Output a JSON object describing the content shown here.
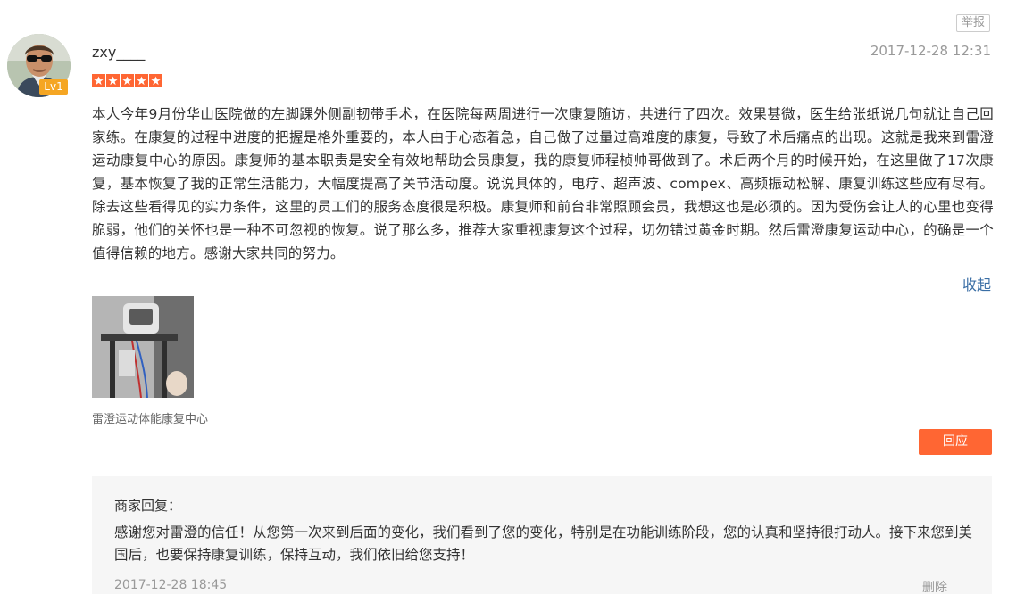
{
  "report_label": "举报",
  "user": {
    "name": "zxy____",
    "level": "Lv1",
    "rating": 5
  },
  "review": {
    "timestamp": "2017-12-28 12:31",
    "text": "本人今年9月份华山医院做的左脚踝外侧副韧带手术，在医院每两周进行一次康复随访，共进行了四次。效果甚微，医生给张纸说几句就让自己回家练。在康复的过程中进度的把握是格外重要的，本人由于心态着急，自己做了过量过高难度的康复，导致了术后痛点的出现。这就是我来到雷澄运动康复中心的原因。康复师的基本职责是安全有效地帮助会员康复，我的康复师程桢帅哥做到了。术后两个月的时候开始，在这里做了17次康复，基本恢复了我的正常生活能力，大幅度提高了关节活动度。说说具体的，电疗、超声波、compex、高频振动松解、康复训练这些应有尽有。除去这些看得见的实力条件，这里的员工们的服务态度很是积极。康复师和前台非常照顾会员，我想这也是必须的。因为受伤会让人的心里也变得脆弱，他们的关怀也是一种不可忽视的恢复。说了那么多，推荐大家重视康复这个过程，切勿错过黄金时期。然后雷澄康复运动中心，的确是一个值得信赖的地方。感谢大家共同的努力。",
    "collapse_label": "收起",
    "photo_caption": "雷澄运动体能康复中心",
    "reply_label": "回应"
  },
  "merchant_reply": {
    "title": "商家回复：",
    "text": "感谢您对雷澄的信任！从您第一次来到后面的变化，我们看到了您的变化，特别是在功能训练阶段，您的认真和坚持很打动人。接下来您到美国后，也要保持康复训练，保持互动，我们依旧给您支持！",
    "timestamp": "2017-12-28 18:45",
    "delete_label": "删除"
  },
  "colors": {
    "accent": "#ff6633",
    "link": "#3a6ea5",
    "muted": "#999999",
    "badge": "#f5a623"
  }
}
